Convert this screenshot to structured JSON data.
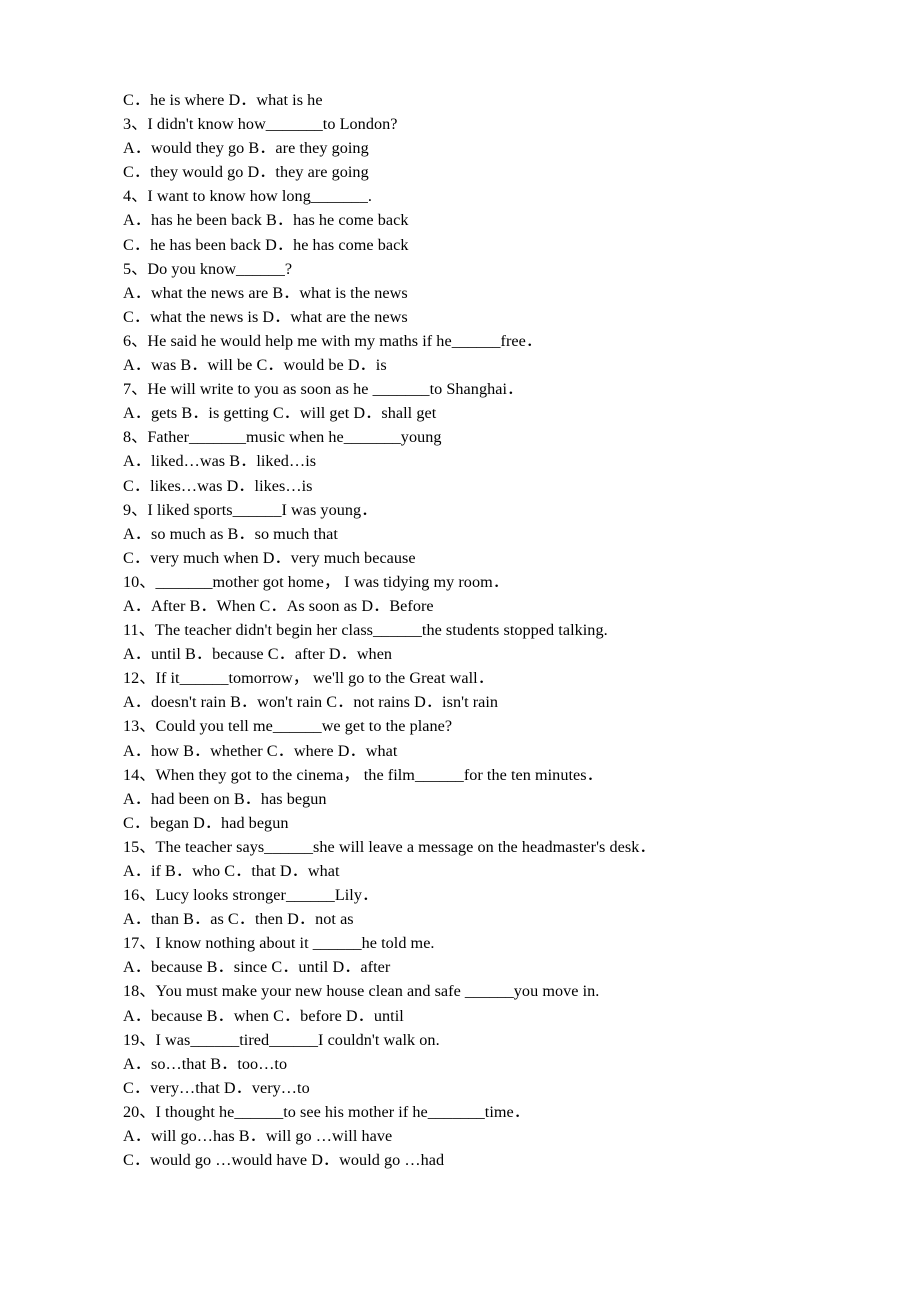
{
  "document": {
    "type": "english-grammar-multiple-choice-worksheet",
    "page_background": "#ffffff",
    "text_color": "#000000",
    "lines": [
      {
        "id": "l01",
        "kind": "options",
        "text": "C．he is where        D．what is he"
      },
      {
        "id": "l02",
        "kind": "question",
        "text": "3、I didn't know how_______to London?"
      },
      {
        "id": "l03",
        "kind": "options",
        "text": "A．would they go        B．are they going"
      },
      {
        "id": "l04",
        "kind": "options",
        "text": "C．they would go      D．they are going"
      },
      {
        "id": "l05",
        "kind": "question",
        "text": "4、I want to know how long_______."
      },
      {
        "id": "l06",
        "kind": "options",
        "text": "A．has he been back      B．has he come back"
      },
      {
        "id": "l07",
        "kind": "options",
        "text": "C．he has been back    D．he has come back"
      },
      {
        "id": "l08",
        "kind": "question",
        "text": "5、Do you know______?"
      },
      {
        "id": "l09",
        "kind": "options",
        "text": "A．what the news are     B．what is the news"
      },
      {
        "id": "l10",
        "kind": "options",
        "text": "C．what the news is     D．what are the news"
      },
      {
        "id": "l11",
        "kind": "question",
        "text": "6、He said he would help me with my maths if he______free．"
      },
      {
        "id": "l12",
        "kind": "options",
        "text": "A．was   B．will be   C．would be     D．is"
      },
      {
        "id": "l13",
        "kind": "question",
        "text": "7、He will write to you as soon as he _______to Shanghai．"
      },
      {
        "id": "l14",
        "kind": "options",
        "text": "A．gets   B．is getting   C．will get     D．shall get"
      },
      {
        "id": "l15",
        "kind": "question",
        "text": "8、Father_______music when he_______young"
      },
      {
        "id": "l16",
        "kind": "options",
        "text": "A．liked…was        B．liked…is"
      },
      {
        "id": "l17",
        "kind": "options",
        "text": "C．likes…was      D．likes…is"
      },
      {
        "id": "l18",
        "kind": "question",
        "text": "9、I liked sports______I was young．"
      },
      {
        "id": "l19",
        "kind": "options",
        "text": "A．so much as      B．so much that"
      },
      {
        "id": "l20",
        "kind": "options",
        "text": "C．very much when     D．very much because"
      },
      {
        "id": "l21",
        "kind": "question",
        "text": "10、_______mother got home，  I was tidying my room．"
      },
      {
        "id": "l22",
        "kind": "options",
        "text": "A．After  B．When  C．As soon as   D．Before"
      },
      {
        "id": "l23",
        "kind": "question",
        "text": "11、The teacher didn't begin her class______the students stopped talking."
      },
      {
        "id": "l24",
        "kind": "options",
        "text": "A．until  B．because  C．after D．when"
      },
      {
        "id": "l25",
        "kind": "question",
        "text": "12、If it______tomorrow，  we'll go to the Great wall．"
      },
      {
        "id": "l26",
        "kind": "options",
        "text": "A．doesn't rain  B．won't rain   C．not rains  D．isn't rain"
      },
      {
        "id": "l27",
        "kind": "question",
        "text": "13、Could you tell me______we get to the plane?"
      },
      {
        "id": "l28",
        "kind": "options",
        "text": "A．how     B．whether    C．where  D．what"
      },
      {
        "id": "l29",
        "kind": "question",
        "text": "14、When they got to the cinema，  the film______for the ten minutes．"
      },
      {
        "id": "l30",
        "kind": "options",
        "text": "A．had been on       B．has begun"
      },
      {
        "id": "l31",
        "kind": "options",
        "text": "C．began     D．had begun"
      },
      {
        "id": "l32",
        "kind": "question",
        "text": "15、The teacher says______she will leave a message on the headmaster's desk．"
      },
      {
        "id": "l33",
        "kind": "options",
        "text": "A．if   B．who  C．that  D．what"
      },
      {
        "id": "l34",
        "kind": "question",
        "text": "16、Lucy looks stronger______Lily．"
      },
      {
        "id": "l35",
        "kind": "options",
        "text": "A．than  B．as  C．then  D．not as"
      },
      {
        "id": "l36",
        "kind": "question",
        "text": "17、I know nothing about it ______he told me."
      },
      {
        "id": "l37",
        "kind": "options",
        "text": "A．because  B．since  C．until  D．after"
      },
      {
        "id": "l38",
        "kind": "question",
        "text": "18、You must make your new house clean and safe ______you move in."
      },
      {
        "id": "l39",
        "kind": "options",
        "text": "A．because  B．when  C．before  D．until"
      },
      {
        "id": "l40",
        "kind": "question",
        "text": "19、I was______tired______I couldn't walk on."
      },
      {
        "id": "l41",
        "kind": "options",
        "text": "A．so…that     B．too…to"
      },
      {
        "id": "l42",
        "kind": "options",
        "text": "C．very…that    D．very…to"
      },
      {
        "id": "l43",
        "kind": "question",
        "text": "20、I thought he______to see his mother if he_______time．"
      },
      {
        "id": "l44",
        "kind": "options",
        "text": "A．will go…has     B．will go …will have"
      },
      {
        "id": "l45",
        "kind": "options",
        "text": "C．would go …would have   D．would go …had"
      }
    ]
  },
  "questions": [
    {
      "number": "3",
      "stem": "I didn't know how_______to London?",
      "choices": [
        {
          "letter": "A．",
          "text": "would they go"
        },
        {
          "letter": "B．",
          "text": "are they going"
        },
        {
          "letter": "C．",
          "text": "they would go"
        },
        {
          "letter": "D．",
          "text": "they are going"
        }
      ]
    },
    {
      "number": "4",
      "stem": "I want to know how long_______.",
      "choices": [
        {
          "letter": "A．",
          "text": "has he been back"
        },
        {
          "letter": "B．",
          "text": "has he come back"
        },
        {
          "letter": "C．",
          "text": "he has been back"
        },
        {
          "letter": "D．",
          "text": "he has come back"
        }
      ]
    },
    {
      "number": "5",
      "stem": "Do you know______?",
      "choices": [
        {
          "letter": "A．",
          "text": "what the news are"
        },
        {
          "letter": "B．",
          "text": "what is the news"
        },
        {
          "letter": "C．",
          "text": "what the news is"
        },
        {
          "letter": "D．",
          "text": "what are the news"
        }
      ]
    },
    {
      "number": "6",
      "stem": "He said he would help me with my maths if he______free．",
      "choices": [
        {
          "letter": "A．",
          "text": "was"
        },
        {
          "letter": "B．",
          "text": "will be"
        },
        {
          "letter": "C．",
          "text": "would be"
        },
        {
          "letter": "D．",
          "text": "is"
        }
      ]
    },
    {
      "number": "7",
      "stem": "He will write to you as soon as he _______to Shanghai．",
      "choices": [
        {
          "letter": "A．",
          "text": "gets"
        },
        {
          "letter": "B．",
          "text": "is getting"
        },
        {
          "letter": "C．",
          "text": "will get"
        },
        {
          "letter": "D．",
          "text": "shall get"
        }
      ]
    },
    {
      "number": "8",
      "stem": "Father_______music when he_______young",
      "choices": [
        {
          "letter": "A．",
          "text": "liked…was"
        },
        {
          "letter": "B．",
          "text": "liked…is"
        },
        {
          "letter": "C．",
          "text": "likes…was"
        },
        {
          "letter": "D．",
          "text": "likes…is"
        }
      ]
    },
    {
      "number": "9",
      "stem": "I liked sports______I was young．",
      "choices": [
        {
          "letter": "A．",
          "text": "so much as"
        },
        {
          "letter": "B．",
          "text": "so much that"
        },
        {
          "letter": "C．",
          "text": "very much when"
        },
        {
          "letter": "D．",
          "text": "very much because"
        }
      ]
    },
    {
      "number": "10",
      "stem": "_______mother got home，  I was tidying my room．",
      "choices": [
        {
          "letter": "A．",
          "text": "After"
        },
        {
          "letter": "B．",
          "text": "When"
        },
        {
          "letter": "C．",
          "text": "As soon as"
        },
        {
          "letter": "D．",
          "text": "Before"
        }
      ]
    },
    {
      "number": "11",
      "stem": "The teacher didn't begin her class______the students stopped talking.",
      "choices": [
        {
          "letter": "A．",
          "text": "until"
        },
        {
          "letter": "B．",
          "text": "because"
        },
        {
          "letter": "C．",
          "text": "after"
        },
        {
          "letter": "D．",
          "text": "when"
        }
      ]
    },
    {
      "number": "12",
      "stem": "If it______tomorrow，  we'll go to the Great wall．",
      "choices": [
        {
          "letter": "A．",
          "text": "doesn't rain"
        },
        {
          "letter": "B．",
          "text": "won't rain"
        },
        {
          "letter": "C．",
          "text": "not rains"
        },
        {
          "letter": "D．",
          "text": "isn't rain"
        }
      ]
    },
    {
      "number": "13",
      "stem": "Could you tell me______we get to the plane?",
      "choices": [
        {
          "letter": "A．",
          "text": "how"
        },
        {
          "letter": "B．",
          "text": "whether"
        },
        {
          "letter": "C．",
          "text": "where"
        },
        {
          "letter": "D．",
          "text": "what"
        }
      ]
    },
    {
      "number": "14",
      "stem": "When they got to the cinema，  the film______for the ten minutes．",
      "choices": [
        {
          "letter": "A．",
          "text": "had been on"
        },
        {
          "letter": "B．",
          "text": "has begun"
        },
        {
          "letter": "C．",
          "text": "began"
        },
        {
          "letter": "D．",
          "text": "had begun"
        }
      ]
    },
    {
      "number": "15",
      "stem": "The teacher says______she will leave a message on the headmaster's desk．",
      "choices": [
        {
          "letter": "A．",
          "text": "if"
        },
        {
          "letter": "B．",
          "text": "who"
        },
        {
          "letter": "C．",
          "text": "that"
        },
        {
          "letter": "D．",
          "text": "what"
        }
      ]
    },
    {
      "number": "16",
      "stem": "Lucy looks stronger______Lily．",
      "choices": [
        {
          "letter": "A．",
          "text": "than"
        },
        {
          "letter": "B．",
          "text": "as"
        },
        {
          "letter": "C．",
          "text": "then"
        },
        {
          "letter": "D．",
          "text": "not as"
        }
      ]
    },
    {
      "number": "17",
      "stem": "I know nothing about it ______he told me.",
      "choices": [
        {
          "letter": "A．",
          "text": "because"
        },
        {
          "letter": "B．",
          "text": "since"
        },
        {
          "letter": "C．",
          "text": "until"
        },
        {
          "letter": "D．",
          "text": "after"
        }
      ]
    },
    {
      "number": "18",
      "stem": "You must make your new house clean and safe ______you move in.",
      "choices": [
        {
          "letter": "A．",
          "text": "because"
        },
        {
          "letter": "B．",
          "text": "when"
        },
        {
          "letter": "C．",
          "text": "before"
        },
        {
          "letter": "D．",
          "text": "until"
        }
      ]
    },
    {
      "number": "19",
      "stem": "I was______tired______I couldn't walk on.",
      "choices": [
        {
          "letter": "A．",
          "text": "so…that"
        },
        {
          "letter": "B．",
          "text": "too…to"
        },
        {
          "letter": "C．",
          "text": "very…that"
        },
        {
          "letter": "D．",
          "text": "very…to"
        }
      ]
    },
    {
      "number": "20",
      "stem": "I thought he______to see his mother if he_______time．",
      "choices": [
        {
          "letter": "A．",
          "text": "will go…has"
        },
        {
          "letter": "B．",
          "text": "will go …will have"
        },
        {
          "letter": "C．",
          "text": "would go …would have"
        },
        {
          "letter": "D．",
          "text": "would go …had"
        }
      ]
    }
  ],
  "orphan_choices_top": [
    {
      "letter": "C．",
      "text": "he is where"
    },
    {
      "letter": "D．",
      "text": "what is he"
    }
  ]
}
